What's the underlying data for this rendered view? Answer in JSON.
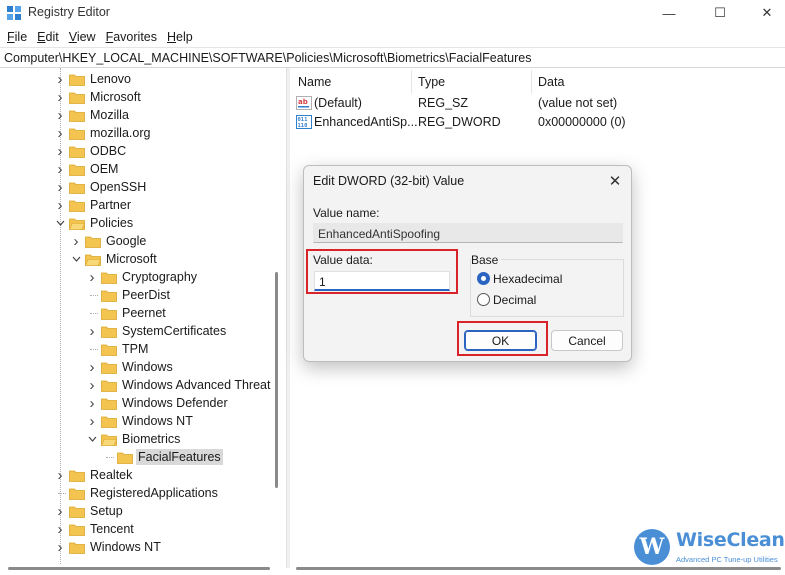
{
  "window": {
    "title": "Registry Editor",
    "minimize_glyph": "—",
    "maximize_glyph": "☐",
    "close_glyph": "✕"
  },
  "menu": [
    {
      "accel": "F",
      "rest": "ile"
    },
    {
      "accel": "E",
      "rest": "dit"
    },
    {
      "accel": "V",
      "rest": "iew"
    },
    {
      "accel": "F",
      "rest": "avorites"
    },
    {
      "accel": "H",
      "rest": "elp"
    }
  ],
  "address": "Computer\\HKEY_LOCAL_MACHINE\\SOFTWARE\\Policies\\Microsoft\\Biometrics\\FacialFeatures",
  "tree": [
    {
      "label": "Lenovo",
      "depth": 0,
      "expander": "collapsed"
    },
    {
      "label": "Microsoft",
      "depth": 0,
      "expander": "collapsed"
    },
    {
      "label": "Mozilla",
      "depth": 0,
      "expander": "collapsed"
    },
    {
      "label": "mozilla.org",
      "depth": 0,
      "expander": "collapsed"
    },
    {
      "label": "ODBC",
      "depth": 0,
      "expander": "collapsed"
    },
    {
      "label": "OEM",
      "depth": 0,
      "expander": "collapsed"
    },
    {
      "label": "OpenSSH",
      "depth": 0,
      "expander": "collapsed"
    },
    {
      "label": "Partner",
      "depth": 0,
      "expander": "collapsed"
    },
    {
      "label": "Policies",
      "depth": 0,
      "expander": "expanded"
    },
    {
      "label": "Google",
      "depth": 1,
      "expander": "collapsed"
    },
    {
      "label": "Microsoft",
      "depth": 1,
      "expander": "expanded"
    },
    {
      "label": "Cryptography",
      "depth": 2,
      "expander": "collapsed"
    },
    {
      "label": "PeerDist",
      "depth": 2,
      "expander": "none"
    },
    {
      "label": "Peernet",
      "depth": 2,
      "expander": "none"
    },
    {
      "label": "SystemCertificates",
      "depth": 2,
      "expander": "collapsed"
    },
    {
      "label": "TPM",
      "depth": 2,
      "expander": "none"
    },
    {
      "label": "Windows",
      "depth": 2,
      "expander": "collapsed"
    },
    {
      "label": "Windows Advanced Threat",
      "depth": 2,
      "expander": "collapsed"
    },
    {
      "label": "Windows Defender",
      "depth": 2,
      "expander": "collapsed"
    },
    {
      "label": "Windows NT",
      "depth": 2,
      "expander": "collapsed"
    },
    {
      "label": "Biometrics",
      "depth": 2,
      "expander": "expanded"
    },
    {
      "label": "FacialFeatures",
      "depth": 3,
      "expander": "none",
      "selected": true
    },
    {
      "label": "Realtek",
      "depth": 0,
      "expander": "collapsed"
    },
    {
      "label": "RegisteredApplications",
      "depth": 0,
      "expander": "none"
    },
    {
      "label": "Setup",
      "depth": 0,
      "expander": "collapsed"
    },
    {
      "label": "Tencent",
      "depth": 0,
      "expander": "collapsed"
    },
    {
      "label": "Windows NT",
      "depth": 0,
      "expander": "collapsed"
    }
  ],
  "list": {
    "columns": [
      "Name",
      "Type",
      "Data"
    ],
    "rows": [
      {
        "icon": "string-value-icon",
        "name": "(Default)",
        "type": "REG_SZ",
        "data": "(value not set)"
      },
      {
        "icon": "binary-value-icon",
        "name": "EnhancedAntiSp...",
        "type": "REG_DWORD",
        "data": "0x00000000 (0)"
      }
    ]
  },
  "dialog": {
    "title": "Edit DWORD (32-bit) Value",
    "close_glyph": "✕",
    "value_name_label": "Value name:",
    "value_name": "EnhancedAntiSpoofing",
    "value_data_label": "Value data:",
    "value_data": "1",
    "base_label": "Base",
    "radio_hex": "Hexadecimal",
    "radio_dec": "Decimal",
    "base_selected": "Hexadecimal",
    "ok_label": "OK",
    "cancel_label": "Cancel"
  },
  "watermark": {
    "logo_letter": "W",
    "name": "WiseCleaner",
    "tagline": "Advanced PC Tune-up Utilities"
  },
  "colors": {
    "accent": "#2a64c0",
    "highlight_box": "#d8232a",
    "folder": "#f3c44f",
    "watermark": "#4a8fd6"
  }
}
